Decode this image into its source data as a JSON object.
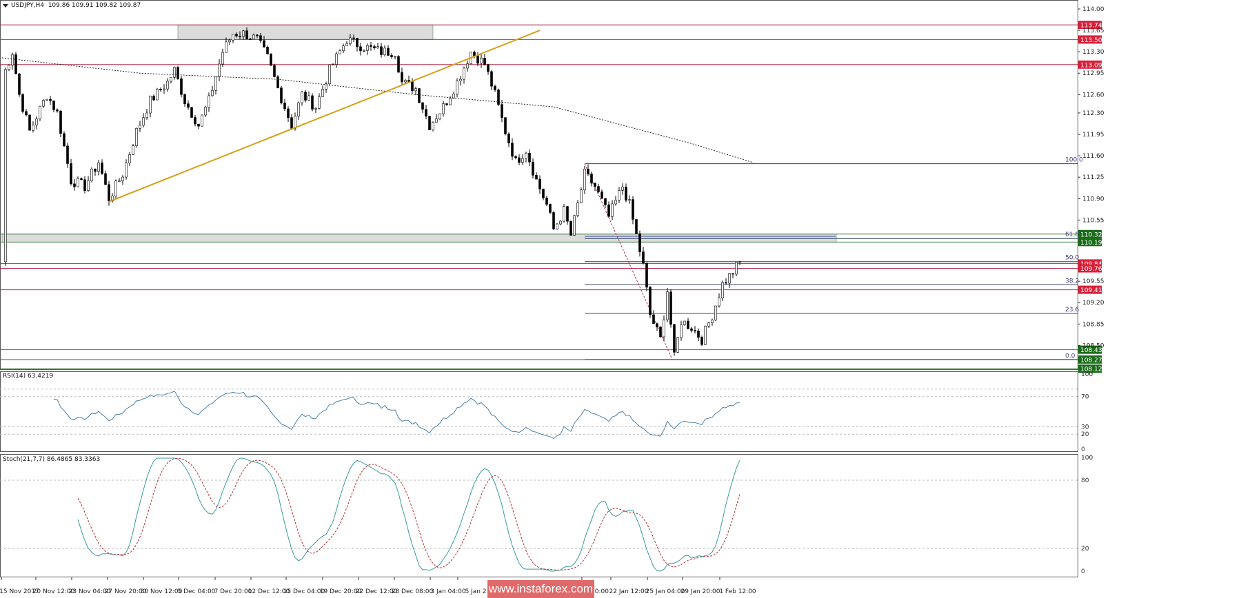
{
  "header": {
    "symbol": "USDJPY,H4",
    "ohlc": "109.86 109.91 109.82 109.87"
  },
  "rsi": {
    "label": "RSI(14) 63.4219",
    "levels": [
      "100",
      "70",
      "30",
      "20",
      "0"
    ]
  },
  "stoch": {
    "label": "Stoch(21,7,7) 86.4865 83.3363",
    "levels": [
      "100",
      "80",
      "20",
      "0"
    ]
  },
  "watermark": "www.instaforex.com",
  "colors": {
    "bull": "#2e8b57",
    "bear": "#8b1a1a",
    "red_line": "#b03050",
    "green_line": "#3a7a3a",
    "trend": "#d4a017",
    "fib": "#2f3f5f",
    "rsi_line": "#4a7fa8"
  },
  "chart_data": {
    "type": "candlestick",
    "title": "USDJPY,H4",
    "ylim": [
      108.12,
      114.0
    ],
    "y_ticks": [
      "114.00",
      "113.65",
      "113.30",
      "112.95",
      "112.60",
      "112.30",
      "111.95",
      "111.60",
      "111.25",
      "110.90",
      "110.55",
      "109.55",
      "109.20",
      "108.85",
      "108.50"
    ],
    "x_ticks": [
      "15 Nov 2017",
      "20 Nov 12:00",
      "23 Nov 04:00",
      "27 Nov 20:00",
      "30 Nov 12:00",
      "5 Dec 04:00",
      "7 Dec 20:00",
      "12 Dec 12:00",
      "15 Dec 04:00",
      "19 Dec 20:00",
      "22 Dec 12:00",
      "28 Dec 08:00",
      "3 Jan 04:00",
      "5 Jan 2",
      "20:00",
      "22 Jan 12:00",
      "25 Jan 04:00",
      "29 Jan 20:00",
      "1 Feb 12:00"
    ],
    "approx_close_by_bar": [
      [
        1,
        113.0
      ],
      [
        3,
        113.3
      ],
      [
        5,
        112.6
      ],
      [
        8,
        112.0
      ],
      [
        13,
        112.6
      ],
      [
        16,
        112.3
      ],
      [
        20,
        111.2
      ],
      [
        24,
        111.1
      ],
      [
        28,
        111.5
      ],
      [
        31,
        110.9
      ],
      [
        35,
        111.3
      ],
      [
        39,
        112.0
      ],
      [
        43,
        112.5
      ],
      [
        48,
        112.8
      ],
      [
        50,
        113.0
      ],
      [
        53,
        112.5
      ],
      [
        57,
        112.1
      ],
      [
        60,
        112.5
      ],
      [
        64,
        113.3
      ],
      [
        67,
        113.6
      ],
      [
        70,
        113.6
      ],
      [
        74,
        113.5
      ],
      [
        77,
        113.2
      ],
      [
        80,
        112.7
      ],
      [
        84,
        112.1
      ],
      [
        87,
        112.6
      ],
      [
        91,
        112.4
      ],
      [
        95,
        113.0
      ],
      [
        100,
        113.5
      ],
      [
        104,
        113.4
      ],
      [
        110,
        113.3
      ],
      [
        114,
        113.3
      ],
      [
        116,
        112.8
      ],
      [
        120,
        112.7
      ],
      [
        124,
        112.1
      ],
      [
        128,
        112.4
      ],
      [
        132,
        112.8
      ],
      [
        136,
        113.3
      ],
      [
        140,
        113.1
      ],
      [
        143,
        112.6
      ],
      [
        146,
        112.0
      ],
      [
        149,
        111.5
      ],
      [
        152,
        111.7
      ],
      [
        155,
        111.2
      ],
      [
        158,
        110.8
      ],
      [
        160,
        110.4
      ],
      [
        163,
        110.7
      ],
      [
        165,
        110.3
      ],
      [
        169,
        111.3
      ],
      [
        172,
        111.1
      ],
      [
        176,
        110.6
      ],
      [
        180,
        111.1
      ],
      [
        182,
        110.8
      ],
      [
        184,
        110.3
      ],
      [
        186,
        109.8
      ],
      [
        188,
        109.0
      ],
      [
        191,
        108.6
      ],
      [
        193,
        109.4
      ],
      [
        195,
        108.3
      ],
      [
        197,
        108.9
      ],
      [
        200,
        108.8
      ],
      [
        203,
        108.6
      ],
      [
        206,
        109.0
      ],
      [
        209,
        109.5
      ],
      [
        212,
        109.7
      ],
      [
        214,
        109.87
      ]
    ],
    "moving_average_by_bar": [
      [
        0,
        113.2
      ],
      [
        40,
        112.95
      ],
      [
        80,
        112.85
      ],
      [
        120,
        112.6
      ],
      [
        140,
        112.5
      ],
      [
        160,
        112.4
      ],
      [
        180,
        112.1
      ],
      [
        200,
        111.8
      ],
      [
        219,
        111.47
      ]
    ],
    "horizontal_levels": [
      {
        "price": 113.74,
        "label": "113.74",
        "kind": "resistance"
      },
      {
        "price": 113.5,
        "label": "113.50",
        "kind": "resistance"
      },
      {
        "price": 113.09,
        "label": "113.09",
        "kind": "resistance"
      },
      {
        "price": 110.32,
        "label": "110.32",
        "kind": "support"
      },
      {
        "price": 110.19,
        "label": "110.19",
        "kind": "support"
      },
      {
        "price": 109.84,
        "label": "109.84",
        "kind": "resistance"
      },
      {
        "price": 109.76,
        "label": "109.76",
        "kind": "resistance"
      },
      {
        "price": 109.41,
        "label": "109.41",
        "kind": "resistance"
      },
      {
        "price": 108.43,
        "label": "108.43",
        "kind": "support"
      },
      {
        "price": 108.27,
        "label": "108.27",
        "kind": "support"
      },
      {
        "price": 108.12,
        "label": "108.12",
        "kind": "support"
      }
    ],
    "fibonacci": {
      "high": 111.47,
      "low": 108.27,
      "levels": [
        {
          "label": "100.0",
          "ratio": 1.0
        },
        {
          "label": "61.8",
          "ratio": 0.618
        },
        {
          "label": "50.0",
          "ratio": 0.5
        },
        {
          "label": "38.2",
          "ratio": 0.382
        },
        {
          "label": "23.6",
          "ratio": 0.236
        },
        {
          "label": "0.0",
          "ratio": 0.0
        }
      ]
    },
    "trendline": {
      "from": [
        31,
        110.85
      ],
      "to": [
        156,
        113.65
      ]
    },
    "zones": [
      {
        "from_bar": 51,
        "to_bar": 125,
        "top": 113.74,
        "bottom": 113.5
      },
      {
        "from_bar": 0,
        "to_bar": 242,
        "top": 110.32,
        "bottom": 110.19
      }
    ]
  }
}
